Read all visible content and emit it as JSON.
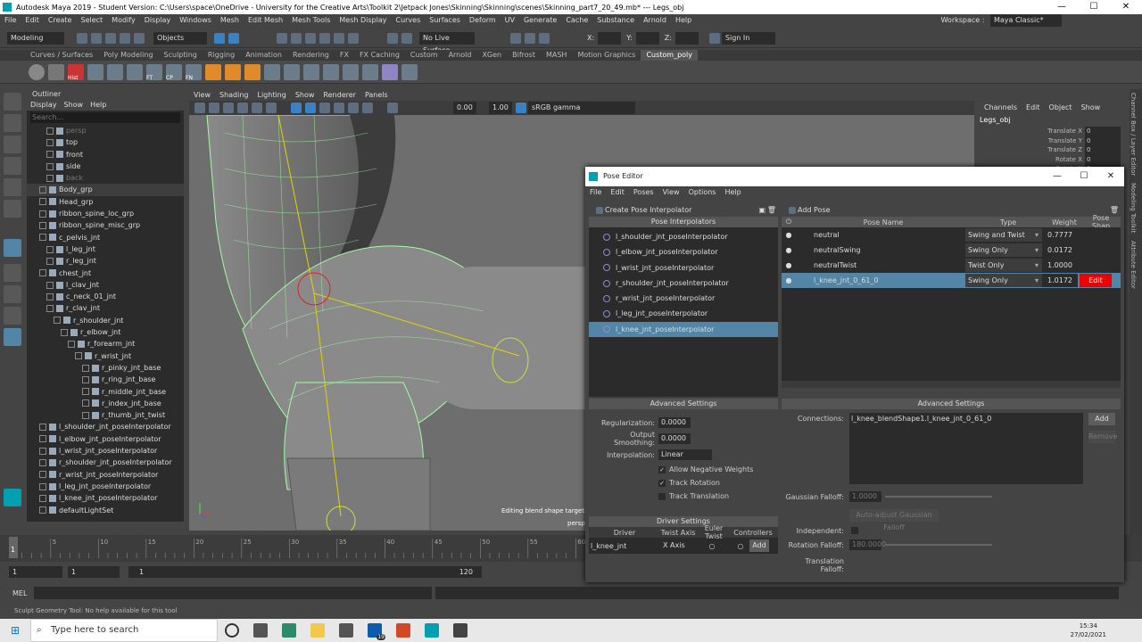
{
  "window": {
    "title": "Autodesk Maya 2019 - Student Version: C:\\Users\\space\\OneDrive - University for the Creative Arts\\Toolkit 2\\Jetpack Jones\\Skinning\\Skinning\\scenes\\Skinning_part7_20_49.mb*  ---  Legs_obj"
  },
  "menubar": [
    "File",
    "Edit",
    "Create",
    "Select",
    "Modify",
    "Display",
    "Windows",
    "Mesh",
    "Edit Mesh",
    "Mesh Tools",
    "Mesh Display",
    "Curves",
    "Surfaces",
    "Deform",
    "UV",
    "Generate",
    "Cache",
    "Substance",
    "Arnold",
    "Help"
  ],
  "workspace": {
    "label": "Workspace :",
    "value": "Maya Classic*"
  },
  "statusline": {
    "mode": "Modeling",
    "objects": "Objects",
    "live_surface": "No Live Surface",
    "x_label": "X:",
    "y_label": "Y:",
    "z_label": "Z:",
    "sign_in": "Sign In"
  },
  "shelf_tabs": [
    "Curves / Surfaces",
    "Poly Modeling",
    "Sculpting",
    "Rigging",
    "Animation",
    "Rendering",
    "FX",
    "FX Caching",
    "Custom",
    "Arnold",
    "XGen",
    "Bifrost",
    "MASH",
    "Motion Graphics",
    "Custom_poly"
  ],
  "shelf_active": "Custom_poly",
  "shelf_labels": [
    "Hist",
    "FT",
    "CP",
    "FN"
  ],
  "outliner": {
    "header": "Outliner",
    "menu": [
      "Display",
      "Show",
      "Help"
    ],
    "search_placeholder": "Search...",
    "items": [
      {
        "label": "persp",
        "indent": 2,
        "dim": true
      },
      {
        "label": "top",
        "indent": 2,
        "dim": false
      },
      {
        "label": "front",
        "indent": 2,
        "dim": false
      },
      {
        "label": "side",
        "indent": 2,
        "dim": false
      },
      {
        "label": "back",
        "indent": 2,
        "dim": true
      },
      {
        "label": "Body_grp",
        "indent": 1,
        "dim": false,
        "sel": true
      },
      {
        "label": "Head_grp",
        "indent": 1,
        "dim": false
      },
      {
        "label": "ribbon_spine_loc_grp",
        "indent": 1,
        "dim": false
      },
      {
        "label": "ribbon_spine_misc_grp",
        "indent": 1,
        "dim": false
      },
      {
        "label": "c_pelvis_jnt",
        "indent": 1,
        "dim": false
      },
      {
        "label": "l_leg_jnt",
        "indent": 2,
        "dim": false
      },
      {
        "label": "r_leg_jnt",
        "indent": 2,
        "dim": false
      },
      {
        "label": "chest_jnt",
        "indent": 1,
        "dim": false
      },
      {
        "label": "l_clav_jnt",
        "indent": 2,
        "dim": false
      },
      {
        "label": "c_neck_01_jnt",
        "indent": 2,
        "dim": false
      },
      {
        "label": "r_clav_jnt",
        "indent": 2,
        "dim": false
      },
      {
        "label": "r_shoulder_jnt",
        "indent": 3,
        "dim": false
      },
      {
        "label": "r_elbow_jnt",
        "indent": 4,
        "dim": false
      },
      {
        "label": "r_forearm_jnt",
        "indent": 5,
        "dim": false
      },
      {
        "label": "r_wrist_jnt",
        "indent": 6,
        "dim": false
      },
      {
        "label": "r_pinky_jnt_base",
        "indent": 7,
        "dim": false
      },
      {
        "label": "r_ring_jnt_base",
        "indent": 7,
        "dim": false
      },
      {
        "label": "r_middle_jnt_base",
        "indent": 7,
        "dim": false
      },
      {
        "label": "r_index_jnt_base",
        "indent": 7,
        "dim": false
      },
      {
        "label": "r_thumb_jnt_twist",
        "indent": 7,
        "dim": false
      },
      {
        "label": "l_shoulder_jnt_poseInterpolator",
        "indent": 1,
        "dim": false
      },
      {
        "label": "l_elbow_jnt_poseInterpolator",
        "indent": 1,
        "dim": false
      },
      {
        "label": "l_wrist_jnt_poseInterpolator",
        "indent": 1,
        "dim": false
      },
      {
        "label": "r_shoulder_jnt_poseInterpolator",
        "indent": 1,
        "dim": false
      },
      {
        "label": "r_wrist_jnt_poseInterpolator",
        "indent": 1,
        "dim": false
      },
      {
        "label": "l_leg_jnt_poseInterpolator",
        "indent": 1,
        "dim": false
      },
      {
        "label": "l_knee_jnt_poseInterpolator",
        "indent": 1,
        "dim": false
      },
      {
        "label": "defaultLightSet",
        "indent": 1,
        "dim": false
      }
    ]
  },
  "viewport": {
    "menu": [
      "View",
      "Shading",
      "Lighting",
      "Show",
      "Renderer",
      "Panels"
    ],
    "exposure": "0.00",
    "gamma": "1.00",
    "color_space": "sRGB gamma",
    "status": "Editing blend shape target: l_",
    "camera": "persp"
  },
  "channelbox": {
    "menu": [
      "Channels",
      "Edit",
      "Object",
      "Show"
    ],
    "object": "Legs_obj",
    "channels": [
      {
        "label": "Translate X",
        "value": "0"
      },
      {
        "label": "Translate Y",
        "value": "0"
      },
      {
        "label": "Translate Z",
        "value": "0"
      },
      {
        "label": "Rotate X",
        "value": "0"
      },
      {
        "label": "Rotate Y",
        "value": "0"
      }
    ]
  },
  "side_tabs": [
    "Channel Box / Layer Editor",
    "Modeling Toolkit",
    "Attribute Editor"
  ],
  "timeline": {
    "ticks": [
      "1",
      "5",
      "10",
      "15",
      "20",
      "25",
      "30",
      "35",
      "40",
      "45",
      "50",
      "55",
      "60"
    ],
    "current": "1"
  },
  "range": {
    "start": "1",
    "anim_start": "1",
    "inner_start": "1",
    "inner_end": "120"
  },
  "mel": {
    "label": "MEL"
  },
  "help_line": "Sculpt Geometry Tool: No help available for this tool",
  "pose_editor": {
    "title": "Pose Editor",
    "menu": [
      "File",
      "Edit",
      "Poses",
      "View",
      "Options",
      "Help"
    ],
    "create_interp": "Create Pose Interpolator",
    "interp_header": "Pose Interpolators",
    "interpolators": [
      {
        "label": "l_shoulder_jnt_poseInterpolator",
        "sel": false
      },
      {
        "label": "l_elbow_jnt_poseInterpolator",
        "sel": false
      },
      {
        "label": "l_wrist_jnt_poseInterpolator",
        "sel": false
      },
      {
        "label": "r_shoulder_jnt_poseInterpolator",
        "sel": false
      },
      {
        "label": "r_wrist_jnt_poseInterpolator",
        "sel": false
      },
      {
        "label": "l_leg_jnt_poseInterpolator",
        "sel": false
      },
      {
        "label": "l_knee_jnt_poseInterpolator",
        "sel": true
      }
    ],
    "add_pose": "Add Pose",
    "pose_headers": {
      "name": "Pose Name",
      "type": "Type",
      "weight": "Weight",
      "shape": "Pose Shap"
    },
    "poses": [
      {
        "name": "neutral",
        "type": "Swing and Twist",
        "weight": "0.7777",
        "sel": false
      },
      {
        "name": "neutralSwing",
        "type": "Swing Only",
        "weight": "0.0172",
        "sel": false
      },
      {
        "name": "neutralTwist",
        "type": "Twist Only",
        "weight": "1.0000",
        "sel": false
      },
      {
        "name": "l_knee_jnt_0_61_0",
        "type": "Swing Only",
        "weight": "1.0172",
        "sel": true
      }
    ],
    "edit_label": "Edit",
    "left_adv": {
      "header": "Advanced Settings",
      "regularization_label": "Regularization:",
      "regularization": "0.0000",
      "smoothing_label": "Output Smoothing:",
      "smoothing": "0.0000",
      "interp_label": "Interpolation:",
      "interp_value": "Linear",
      "allow_neg": "Allow Negative Weights",
      "track_rot": "Track Rotation",
      "track_trans": "Track Translation"
    },
    "driver": {
      "header": "Driver Settings",
      "cols": [
        "Driver",
        "Twist Axis",
        "Euler Twist",
        "Controllers"
      ],
      "driver": "l_knee_jnt",
      "twist_axis": "X Axis",
      "add": "Add"
    },
    "right_adv": {
      "header": "Advanced Settings",
      "connections_label": "Connections:",
      "connection": "l_knee_blendShape1.l_knee_jnt_0_61_0",
      "add": "Add",
      "remove": "Remove",
      "gaussian_label": "Gaussian Falloff:",
      "gaussian": "1.0000",
      "auto_adjust": "Auto-adjust Gaussian Falloff",
      "independent_label": "Independent:",
      "rot_falloff_label": "Rotation Falloff:",
      "rot_falloff": "180.0000",
      "trans_falloff_label": "Translation Falloff:"
    }
  },
  "taskbar": {
    "search": "Type here to search",
    "time": "15:34",
    "date": "27/02/2021",
    "badge": "19"
  }
}
